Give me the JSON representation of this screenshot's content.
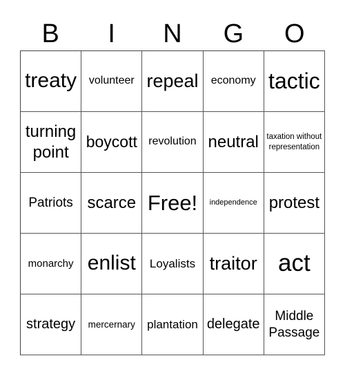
{
  "header": {
    "letters": [
      "B",
      "I",
      "N",
      "G",
      "O"
    ]
  },
  "card": {
    "cells": [
      "treaty",
      "volunteer",
      "repeal",
      "economy",
      "tactic",
      "turning point",
      "boycott",
      "revolution",
      "neutral",
      "taxation without representation",
      "Patriots",
      "scarce",
      "Free!",
      "independence",
      "protest",
      "monarchy",
      "enlist",
      "Loyalists",
      "traitor",
      "act",
      "strategy",
      "mercernary",
      "plantation",
      "delegate",
      "Middle Passage"
    ]
  }
}
